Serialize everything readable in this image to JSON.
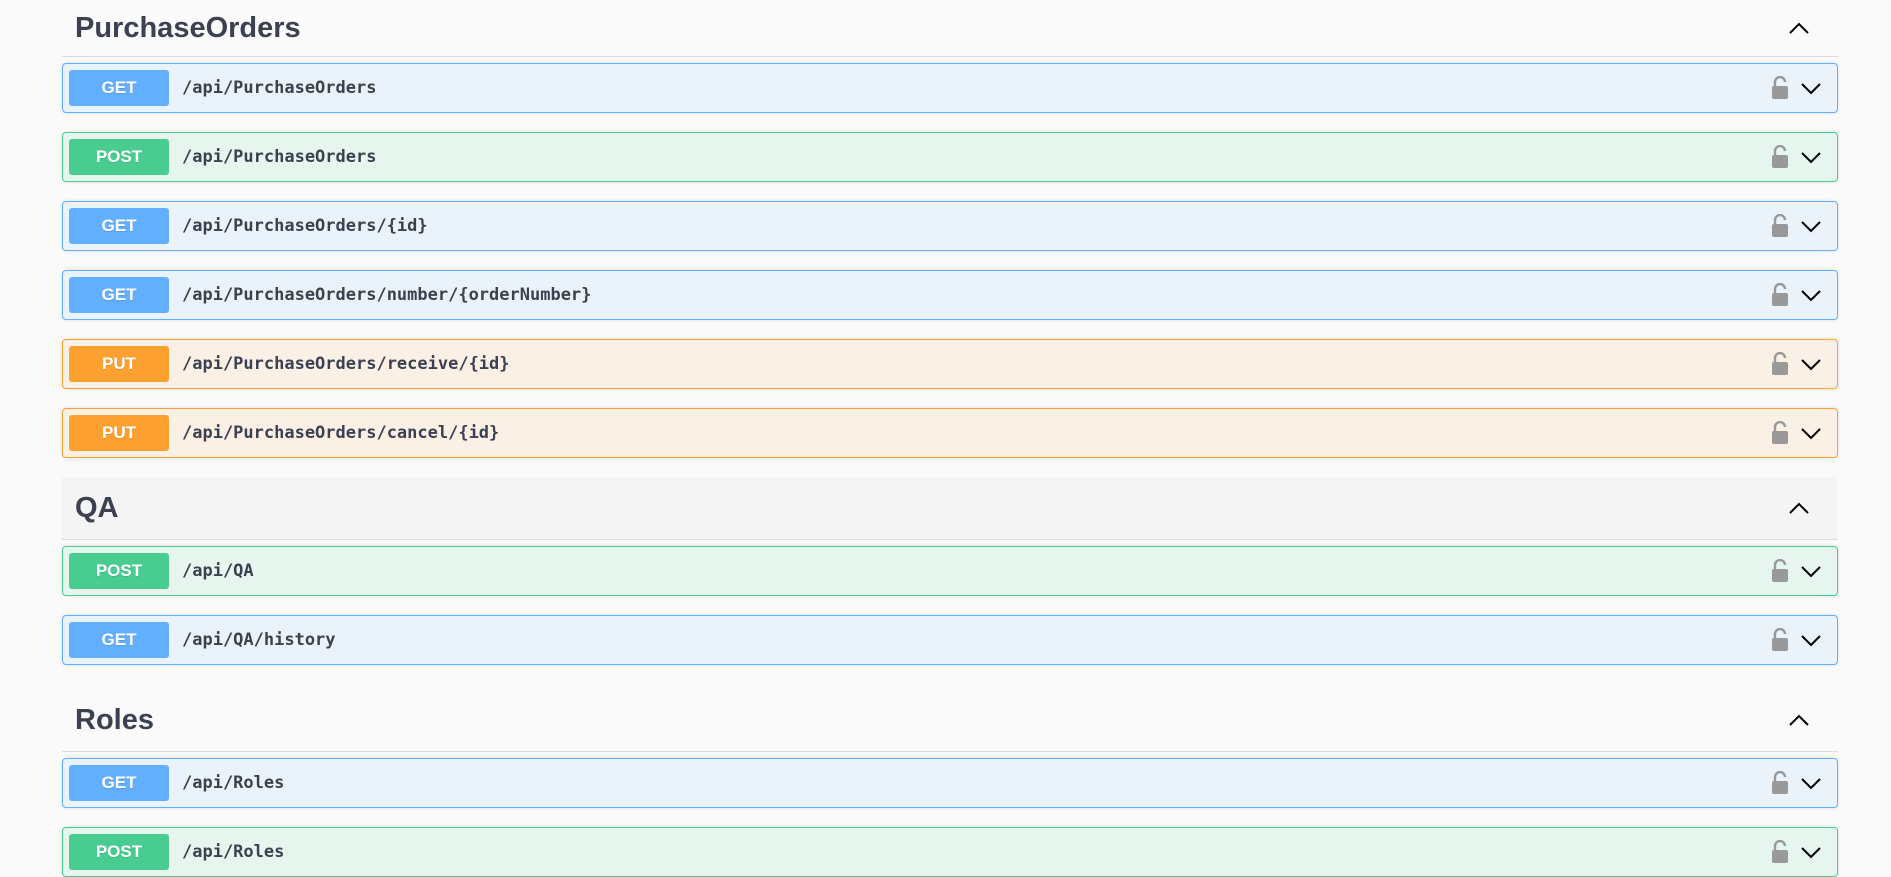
{
  "sections": [
    {
      "title": "PurchaseOrders",
      "operations": [
        {
          "method": "GET",
          "path": "/api/PurchaseOrders"
        },
        {
          "method": "POST",
          "path": "/api/PurchaseOrders"
        },
        {
          "method": "GET",
          "path": "/api/PurchaseOrders/{id}"
        },
        {
          "method": "GET",
          "path": "/api/PurchaseOrders/number/{orderNumber}"
        },
        {
          "method": "PUT",
          "path": "/api/PurchaseOrders/receive/{id}"
        },
        {
          "method": "PUT",
          "path": "/api/PurchaseOrders/cancel/{id}"
        }
      ]
    },
    {
      "title": "QA",
      "operations": [
        {
          "method": "POST",
          "path": "/api/QA"
        },
        {
          "method": "GET",
          "path": "/api/QA/history"
        }
      ]
    },
    {
      "title": "Roles",
      "operations": [
        {
          "method": "GET",
          "path": "/api/Roles"
        },
        {
          "method": "POST",
          "path": "/api/Roles"
        }
      ]
    }
  ],
  "colors": {
    "get": "#61affe",
    "post": "#49cc90",
    "put": "#fca130",
    "text": "#3b4151"
  },
  "icons": {
    "section_toggle": "chevron-up-icon",
    "operation_lock": "lock-icon",
    "operation_toggle": "chevron-down-icon"
  }
}
